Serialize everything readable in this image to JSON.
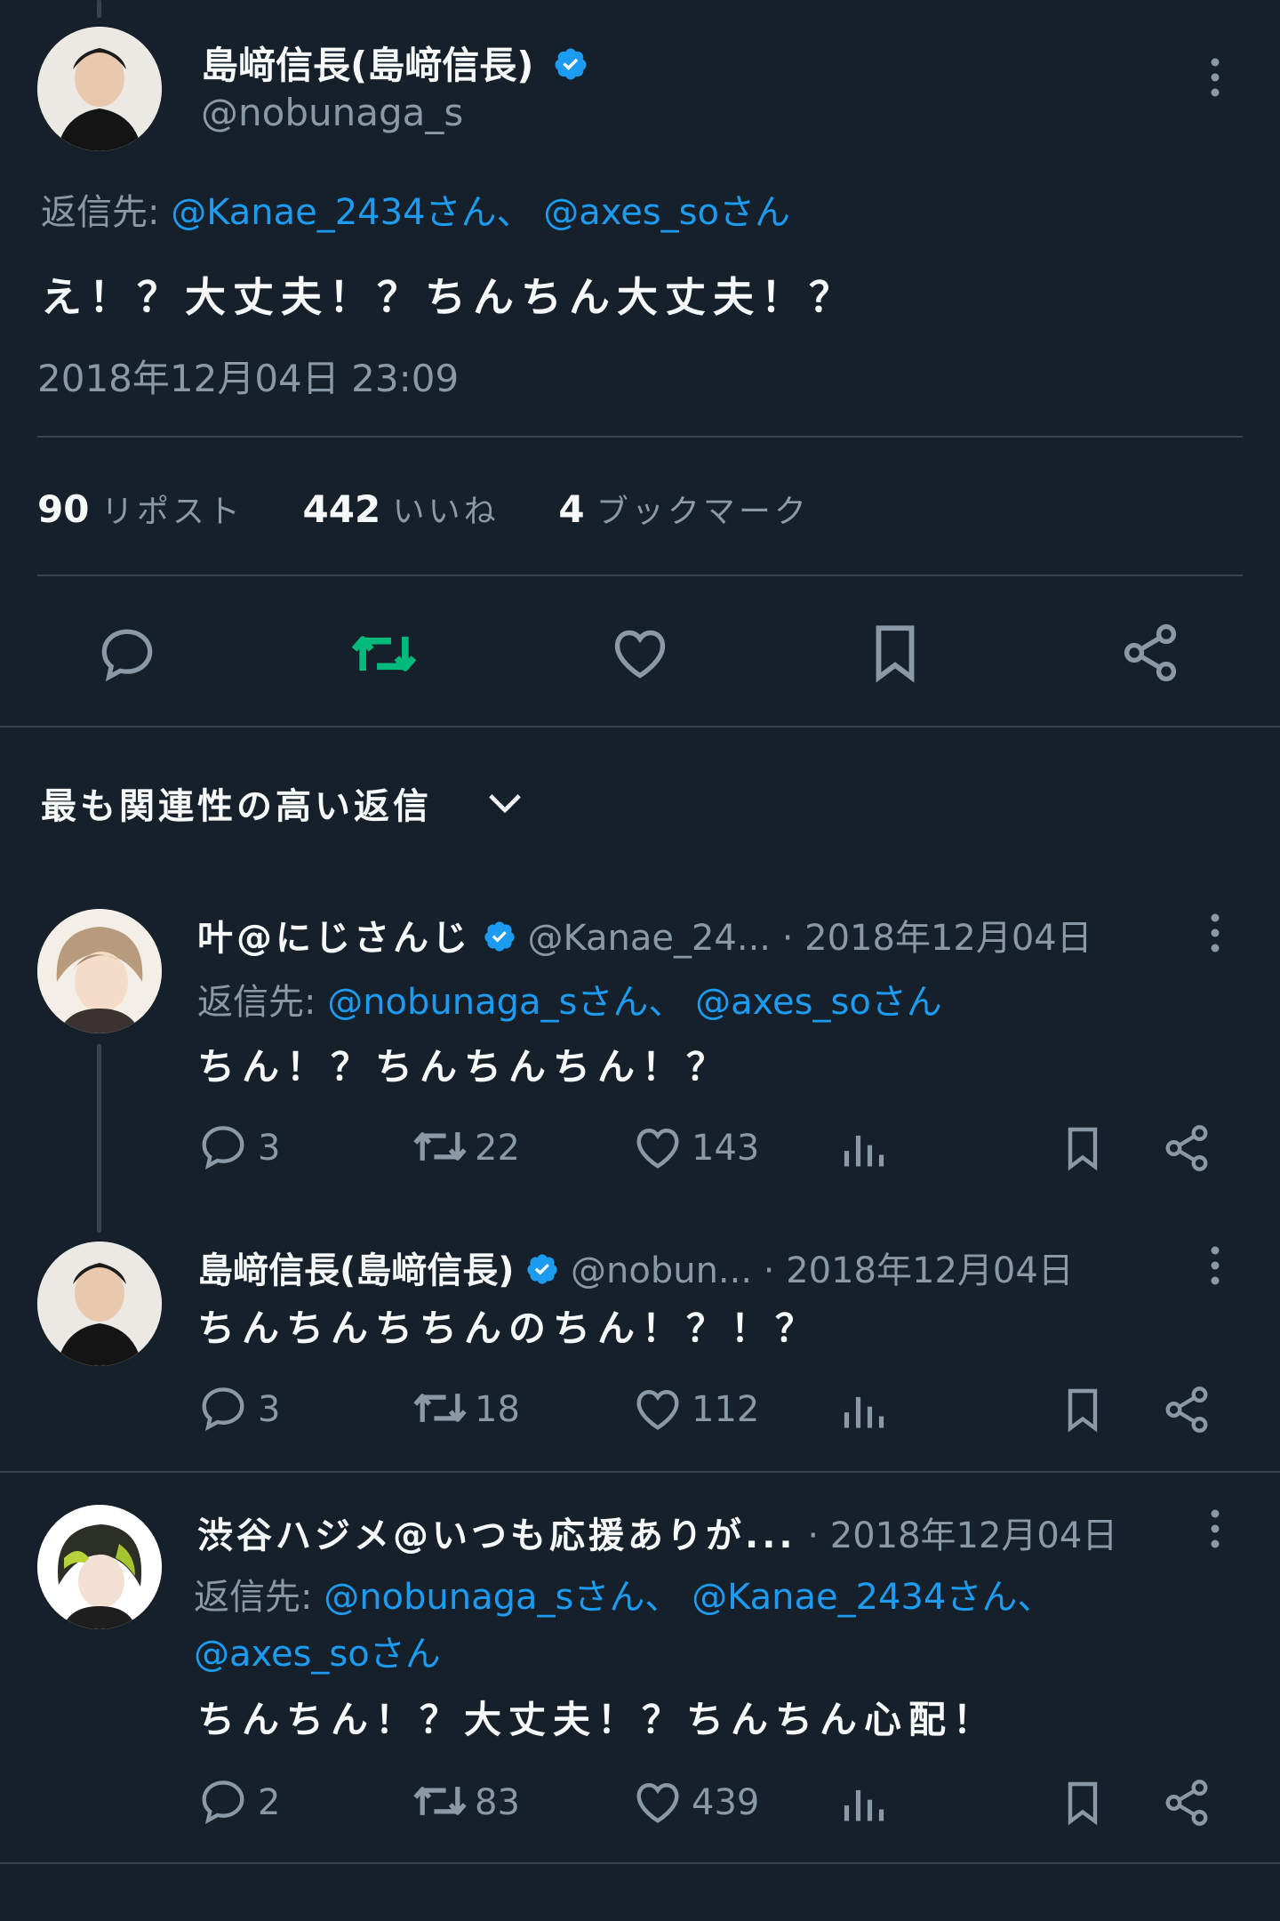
{
  "main_tweet": {
    "display_name": "島﨑信長(島﨑信長)",
    "handle": "@nobunaga_s",
    "reply_label": "返信先:",
    "reply_to": [
      {
        "handle": "@Kanae_2434",
        "suffix": "さん、"
      },
      {
        "handle": "@axes_so",
        "suffix": "さん"
      }
    ],
    "text": "え！？大丈夫！？ちんちん大丈夫！？",
    "timestamp": "2018年12月04日 23:09",
    "stats": {
      "reposts_count": "90",
      "reposts_label": "リポスト",
      "likes_count": "442",
      "likes_label": "いいね",
      "bookmarks_count": "4",
      "bookmarks_label": "ブックマーク"
    }
  },
  "sort": {
    "label": "最も関連性の高い返信"
  },
  "replies": [
    {
      "display_name": "叶@にじさんじ",
      "handle": "@Kanae_24...",
      "date": "· 2018年12月04日",
      "reply_label": "返信先:",
      "reply_to": [
        {
          "handle": "@nobunaga_s",
          "suffix": "さん、"
        },
        {
          "handle": "@axes_so",
          "suffix": "さん"
        }
      ],
      "text": "ちん！？ちんちんちん！？",
      "replies": "3",
      "reposts": "22",
      "likes": "143"
    },
    {
      "display_name": "島﨑信長(島﨑信長)",
      "handle": "@nobun...",
      "date": "· 2018年12月04日",
      "text": "ちんちんちちんのちん！？！？",
      "replies": "3",
      "reposts": "18",
      "likes": "112"
    },
    {
      "display_name": "渋谷ハジメ@いつも応援ありが...",
      "date": "· 2018年12月04日",
      "reply_label": "返信先:",
      "reply_to": [
        {
          "handle": "@nobunaga_s",
          "suffix": "さん、"
        },
        {
          "handle": "@Kanae_2434",
          "suffix": "さん、"
        },
        {
          "handle": "@axes_so",
          "suffix": "さん"
        }
      ],
      "text": "ちんちん！？大丈夫！？ちんちん心配！",
      "replies": "2",
      "reposts": "83",
      "likes": "439"
    }
  ],
  "colors": {
    "background": "#15202b",
    "accent": "#1d9bf0",
    "repost_active": "#00ba7c",
    "muted": "#8b98a5"
  }
}
